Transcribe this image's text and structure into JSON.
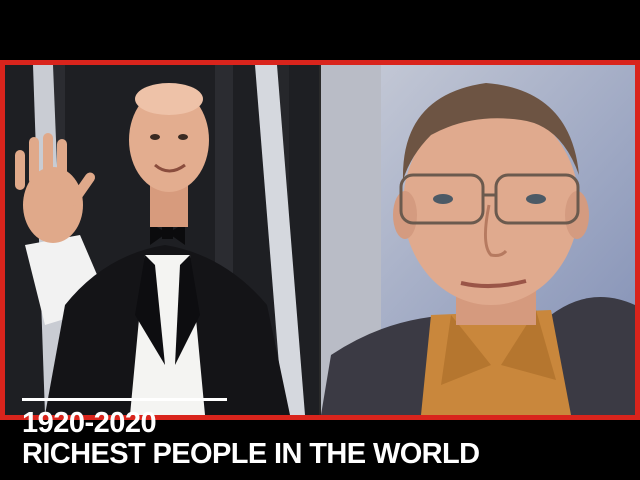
{
  "caption": {
    "years": "1920-2020",
    "headline": "RICHEST PEOPLE IN THE WORLD"
  },
  "colors": {
    "frame": "#d9241c",
    "caption_text": "#ffffff",
    "background": "#000000"
  }
}
